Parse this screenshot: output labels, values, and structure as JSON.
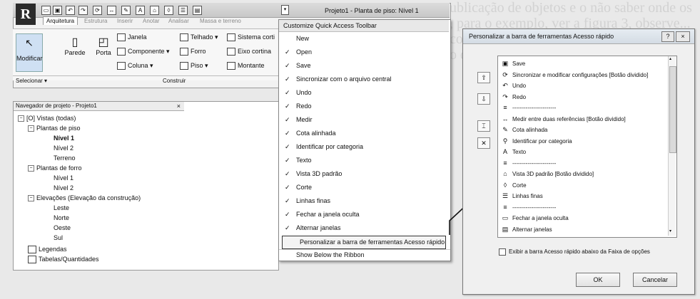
{
  "background_text": "ublicação de objetos e o não saber onde os\n, para o exemplo, ver a figura 3, observe...\ncom uma lista de ferramentas que...\no de caminho",
  "titlebar": {
    "window_title": "Projeto1 - Planta de piso: Nível 1",
    "app_logo": "R"
  },
  "tabs": [
    "Arquitetura",
    "Estrutura",
    "Inserir",
    "Anotar",
    "Analisar",
    "Massa e terreno"
  ],
  "ribbon": {
    "modificar": "Modificar",
    "parede": "Parede",
    "porta": "Porta",
    "janela": "Janela",
    "componente": "Componente",
    "coluna": "Coluna",
    "telhado": "Telhado",
    "forro": "Forro",
    "piso": "Piso",
    "sistema_cortina": "Sistema corti",
    "eixo_cortina": "Eixo cortina",
    "montante": "Montante",
    "selecionar": "Selecionar",
    "construir": "Construir"
  },
  "navigator": {
    "title": "Navegador de projeto - Projeto1",
    "close": "×",
    "items": [
      {
        "label": "[O] Vistas (todas)",
        "box": "−"
      },
      {
        "label": "Plantas de piso",
        "box": "−"
      },
      {
        "label": "Nível 1"
      },
      {
        "label": "Nível 2"
      },
      {
        "label": "Terreno"
      },
      {
        "label": "Plantas de forro",
        "box": "−"
      },
      {
        "label": "Nível 1"
      },
      {
        "label": "Nível 2"
      },
      {
        "label": "Elevações (Elevação da construção)",
        "box": "−"
      },
      {
        "label": "Leste"
      },
      {
        "label": "Norte"
      },
      {
        "label": "Oeste"
      },
      {
        "label": "Sul"
      },
      {
        "label": "Legendas"
      },
      {
        "label": "Tabelas/Quantidades"
      }
    ]
  },
  "menu": {
    "title": "Customize Quick Access Toolbar",
    "items": [
      {
        "label": "New",
        "checked": false
      },
      {
        "label": "Open",
        "checked": true
      },
      {
        "label": "Save",
        "checked": true
      },
      {
        "label": "Sincronizar com o arquivo central",
        "checked": true
      },
      {
        "label": "Undo",
        "checked": true
      },
      {
        "label": "Redo",
        "checked": true
      },
      {
        "label": "Medir",
        "checked": true
      },
      {
        "label": "Cota alinhada",
        "checked": true
      },
      {
        "label": "Identificar por categoria",
        "checked": true
      },
      {
        "label": "Texto",
        "checked": true
      },
      {
        "label": "Vista 3D padrão",
        "checked": true
      },
      {
        "label": "Corte",
        "checked": true
      },
      {
        "label": "Linhas finas",
        "checked": true
      },
      {
        "label": "Fechar a janela oculta",
        "checked": true
      },
      {
        "label": "Alternar janelas",
        "checked": true
      }
    ],
    "personalizar": "Personalizar a barra de ferramentas Acesso rápido",
    "show_below": "Show Below the Ribbon",
    "check_glyph": "✓"
  },
  "dialog": {
    "title": "Personalizar a barra de ferramentas Acesso rápido",
    "help": "?",
    "close": "×",
    "list": [
      {
        "icon": "▣",
        "label": "Save"
      },
      {
        "icon": "⟳",
        "label": "Sincronizar e modificar configurações [Botão dividido]"
      },
      {
        "icon": "↶",
        "label": "Undo"
      },
      {
        "icon": "↷",
        "label": "Redo"
      },
      {
        "icon": "≡",
        "label": "-----------------------"
      },
      {
        "icon": "↔",
        "label": "Medir entre duas referências [Botão dividido]"
      },
      {
        "icon": "✎",
        "label": "Cota alinhada"
      },
      {
        "icon": "⚲",
        "label": "Identificar por categoria"
      },
      {
        "icon": "A",
        "label": "Texto"
      },
      {
        "icon": "≡",
        "label": "-----------------------"
      },
      {
        "icon": "⌂",
        "label": "Vista 3D padrão [Botão dividido]"
      },
      {
        "icon": "◊",
        "label": "Corte"
      },
      {
        "icon": "☰",
        "label": "Linhas finas"
      },
      {
        "icon": "≡",
        "label": "-----------------------"
      },
      {
        "icon": "▭",
        "label": "Fechar a janela oculta"
      },
      {
        "icon": "▤",
        "label": "Alternar janelas"
      }
    ],
    "checkbox_label": "Exibir a barra Acesso rápido abaixo da Faixa de opções",
    "ok": "OK",
    "cancel": "Cancelar"
  }
}
